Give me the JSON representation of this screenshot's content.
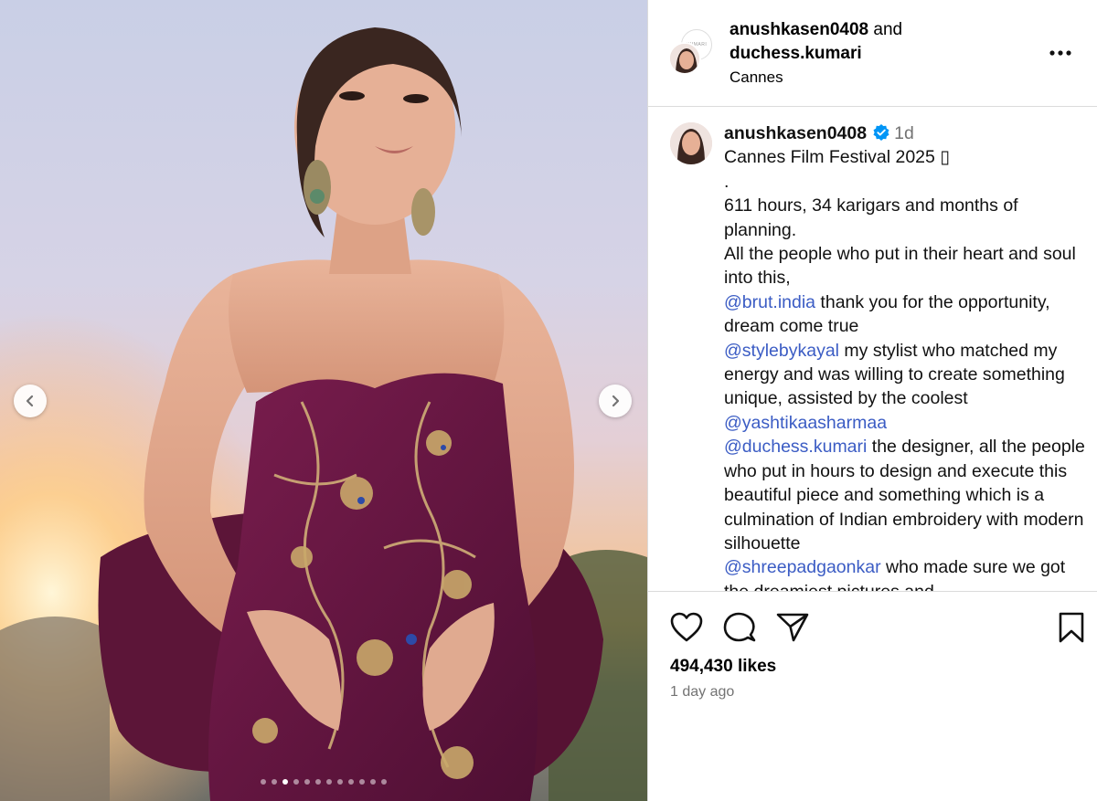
{
  "header": {
    "user1": "anushkasen0408",
    "and_word": "and",
    "user2": "duchess.kumari",
    "location": "Cannes",
    "collab_avatar_text": "KUMARI"
  },
  "post": {
    "username": "anushkasen0408",
    "time": "1d",
    "caption_lines": [
      {
        "text": "Cannes Film Festival 2025 ▯"
      },
      {
        "text": "."
      },
      {
        "text": "611 hours, 34 karigars and months of planning."
      },
      {
        "text": "All the people who put in their heart and soul into this,"
      },
      {
        "mention": "@brut.india",
        "text": " thank you for the opportunity, dream come true"
      },
      {
        "mention": "@stylebykayal",
        "text": " my stylist who matched my energy and was willing to create something unique, assisted by the coolest"
      },
      {
        "mention": "@yashtikaasharmaa",
        "text": ""
      },
      {
        "mention": "@duchess.kumari",
        "text": " the designer, all the people who put in hours to design and execute this beautiful piece and something which is a culmination of Indian embroidery with modern silhouette"
      },
      {
        "mention": "@shreepadgaonkar",
        "text": " who made sure we got the dreamiest pictures and"
      }
    ]
  },
  "stats": {
    "likes": "494,430 likes",
    "posted": "1 day ago"
  },
  "carousel": {
    "dot_count": 12,
    "active_index": 2
  },
  "colors": {
    "mention": "#3b5cc4",
    "verified": "#0095f6",
    "muted": "#737373",
    "divider": "#dbdbdb"
  }
}
